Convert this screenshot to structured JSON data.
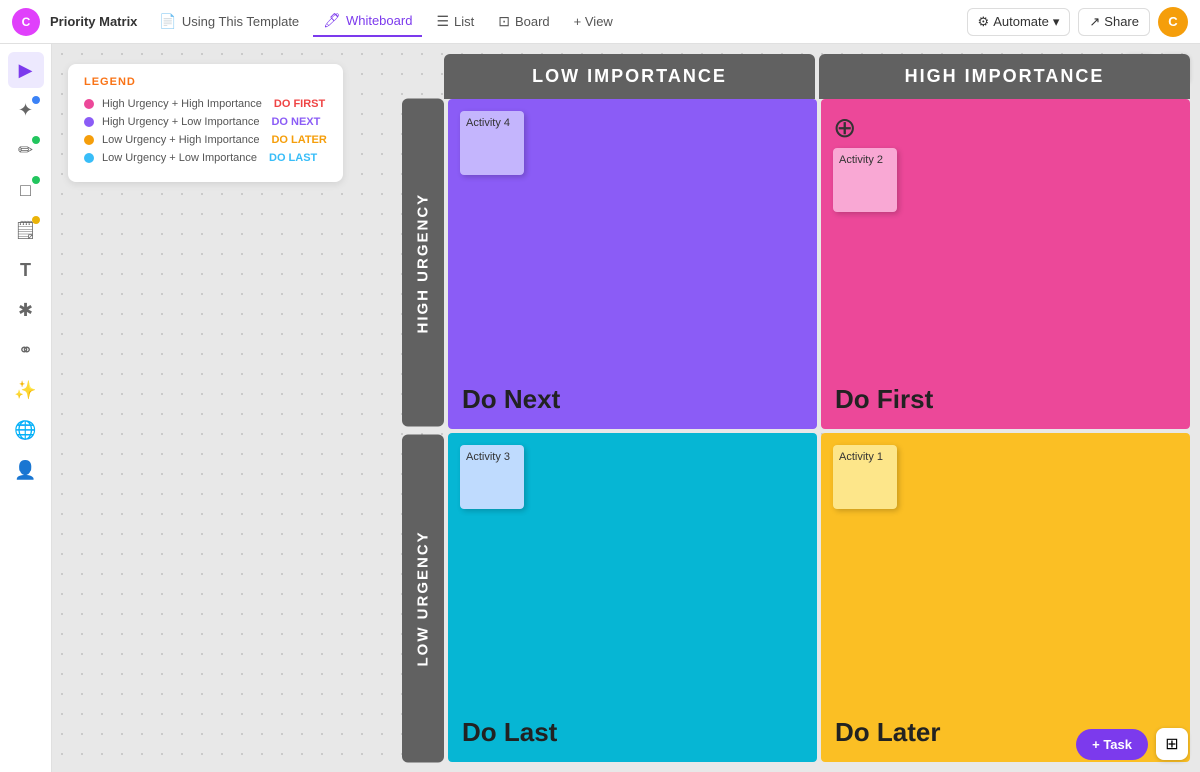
{
  "app": {
    "logo_letter": "C",
    "title": "Priority Matrix"
  },
  "nav": {
    "tabs": [
      {
        "id": "template",
        "label": "Using This Template",
        "icon": "📄",
        "active": false
      },
      {
        "id": "whiteboard",
        "label": "Whiteboard",
        "icon": "🖊",
        "active": true
      },
      {
        "id": "list",
        "label": "List",
        "icon": "☰",
        "active": false
      },
      {
        "id": "board",
        "label": "Board",
        "icon": "⊡",
        "active": false
      },
      {
        "id": "view",
        "label": "+ View",
        "icon": "",
        "active": false
      }
    ],
    "automate_label": "Automate",
    "share_label": "Share",
    "avatar_letter": "C"
  },
  "sidebar": {
    "items": [
      {
        "id": "cursor",
        "icon": "▶",
        "active": true
      },
      {
        "id": "ai",
        "icon": "✦",
        "active": false,
        "dot": "blue"
      },
      {
        "id": "pen",
        "icon": "✏",
        "active": false,
        "dot": "green"
      },
      {
        "id": "rect",
        "icon": "□",
        "active": false,
        "dot": "green"
      },
      {
        "id": "sticky",
        "icon": "🗒",
        "active": false,
        "dot": "yellow"
      },
      {
        "id": "text",
        "icon": "T",
        "active": false
      },
      {
        "id": "magic",
        "icon": "✱",
        "active": false
      },
      {
        "id": "connect",
        "icon": "⚭",
        "active": false
      },
      {
        "id": "star",
        "icon": "✨",
        "active": false
      },
      {
        "id": "globe",
        "icon": "🌐",
        "active": false
      },
      {
        "id": "person",
        "icon": "👤",
        "active": false
      }
    ]
  },
  "legend": {
    "title": "LEGEND",
    "items": [
      {
        "color": "#ec4899",
        "label": "High Urgency + High Importance",
        "action": "DO FIRST",
        "action_class": "do-first"
      },
      {
        "color": "#8b5cf6",
        "label": "High Urgency + Low Importance",
        "action": "DO NEXT",
        "action_class": "do-next"
      },
      {
        "color": "#f59e0b",
        "label": "Low Urgency + High Importance",
        "action": "DO LATER",
        "action_class": "do-later"
      },
      {
        "color": "#38bdf8",
        "label": "Low Urgency + Low Importance",
        "action": "DO LAST",
        "action_class": "do-last"
      }
    ]
  },
  "matrix": {
    "col_headers": [
      "LOW IMPORTANCE",
      "HIGH IMPORTANCE"
    ],
    "row_headers": [
      "HIGH URGENCY",
      "LOW URGENCY"
    ],
    "cells": [
      {
        "id": "top-left",
        "color": "cell-purple",
        "label": "Do Next",
        "sticky": {
          "text": "Activity 4",
          "color": "sticky-purple"
        }
      },
      {
        "id": "top-right",
        "color": "cell-pink",
        "label": "Do First",
        "sticky": {
          "text": "Activity 2",
          "color": "sticky-pink"
        },
        "has_alert": true
      },
      {
        "id": "bottom-left",
        "color": "cell-cyan",
        "label": "Do Last",
        "sticky": {
          "text": "Activity 3",
          "color": "sticky-blue"
        }
      },
      {
        "id": "bottom-right",
        "color": "cell-yellow",
        "label": "Do Later",
        "sticky": {
          "text": "Activity 1",
          "color": "sticky-peach"
        }
      }
    ]
  },
  "bottom_right": {
    "task_button": "+ Task"
  }
}
